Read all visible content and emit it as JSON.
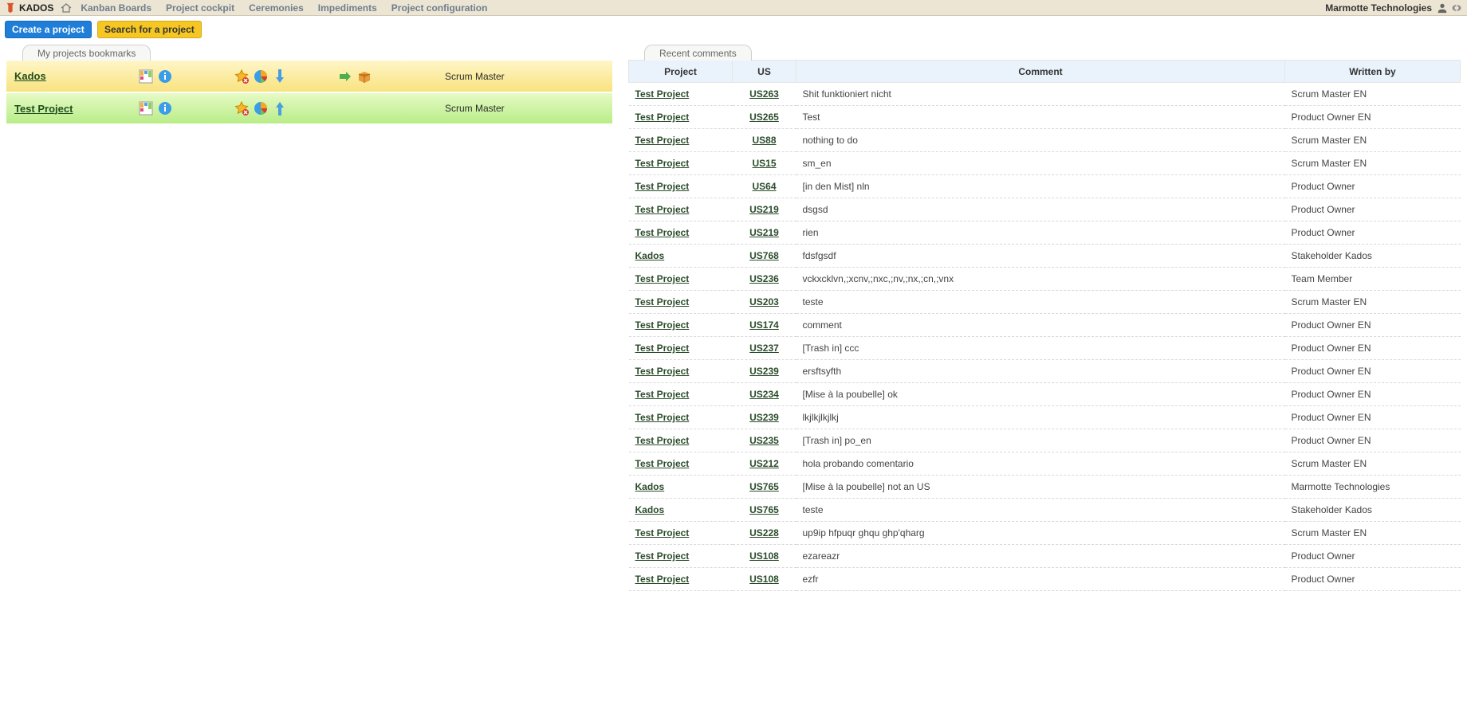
{
  "nav": {
    "brand": "KADOS",
    "items": [
      "Kanban Boards",
      "Project cockpit",
      "Ceremonies",
      "Impediments",
      "Project configuration"
    ],
    "org": "Marmotte Technologies"
  },
  "actions": {
    "create": "Create a project",
    "search": "Search for a project"
  },
  "bookmarks": {
    "title": "My projects bookmarks",
    "rows": [
      {
        "name": "Kados",
        "role": "Scrum Master",
        "arrow": "down",
        "packs": true
      },
      {
        "name": "Test Project",
        "role": "Scrum Master",
        "arrow": "up",
        "packs": false
      }
    ]
  },
  "comments": {
    "title": "Recent comments",
    "headers": {
      "project": "Project",
      "us": "US",
      "comment": "Comment",
      "writer": "Written by"
    },
    "rows": [
      {
        "project": "Test Project",
        "us": "US263",
        "comment": "Shit funktioniert nicht",
        "writer": "Scrum Master EN"
      },
      {
        "project": "Test Project",
        "us": "US265",
        "comment": "Test",
        "writer": "Product Owner EN"
      },
      {
        "project": "Test Project",
        "us": "US88",
        "comment": "nothing to do",
        "writer": "Scrum Master EN"
      },
      {
        "project": "Test Project",
        "us": "US15",
        "comment": "sm_en",
        "writer": "Scrum Master EN"
      },
      {
        "project": "Test Project",
        "us": "US64",
        "comment": "[in den Mist] nln",
        "writer": "Product Owner"
      },
      {
        "project": "Test Project",
        "us": "US219",
        "comment": "dsgsd",
        "writer": "Product Owner"
      },
      {
        "project": "Test Project",
        "us": "US219",
        "comment": "rien",
        "writer": "Product Owner"
      },
      {
        "project": "Kados",
        "us": "US768",
        "comment": "fdsfgsdf",
        "writer": "Stakeholder Kados"
      },
      {
        "project": "Test Project",
        "us": "US236",
        "comment": "vckxcklvn,;xcnv,;nxc,;nv,;nx,;cn,;vnx",
        "writer": "Team Member"
      },
      {
        "project": "Test Project",
        "us": "US203",
        "comment": "teste",
        "writer": "Scrum Master EN"
      },
      {
        "project": "Test Project",
        "us": "US174",
        "comment": "comment",
        "writer": "Product Owner EN"
      },
      {
        "project": "Test Project",
        "us": "US237",
        "comment": "[Trash in] ccc",
        "writer": "Product Owner EN"
      },
      {
        "project": "Test Project",
        "us": "US239",
        "comment": "ersftsyfth",
        "writer": "Product Owner EN"
      },
      {
        "project": "Test Project",
        "us": "US234",
        "comment": "[Mise à la poubelle] ok",
        "writer": "Product Owner EN"
      },
      {
        "project": "Test Project",
        "us": "US239",
        "comment": "lkjlkjlkjlkj",
        "writer": "Product Owner EN"
      },
      {
        "project": "Test Project",
        "us": "US235",
        "comment": "[Trash in] po_en",
        "writer": "Product Owner EN"
      },
      {
        "project": "Test Project",
        "us": "US212",
        "comment": "hola probando comentario",
        "writer": "Scrum Master EN"
      },
      {
        "project": "Kados",
        "us": "US765",
        "comment": "[Mise à la poubelle] not an US",
        "writer": "Marmotte Technologies"
      },
      {
        "project": "Kados",
        "us": "US765",
        "comment": "teste",
        "writer": "Stakeholder Kados"
      },
      {
        "project": "Test Project",
        "us": "US228",
        "comment": "up9ip hfpuqr ghqu ghp'qharg",
        "writer": "Scrum Master EN"
      },
      {
        "project": "Test Project",
        "us": "US108",
        "comment": "ezareazr",
        "writer": "Product Owner"
      },
      {
        "project": "Test Project",
        "us": "US108",
        "comment": "ezfr",
        "writer": "Product Owner"
      }
    ]
  }
}
